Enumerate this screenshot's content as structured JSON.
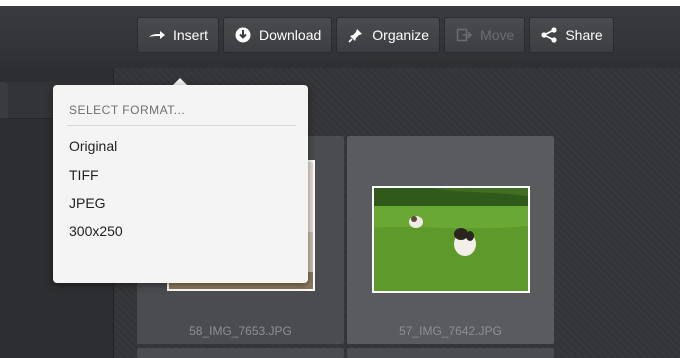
{
  "toolbar": {
    "insert": "Insert",
    "download": "Download",
    "organize": "Organize",
    "move": "Move",
    "share": "Share"
  },
  "format_menu": {
    "title": "SELECT FORMAT...",
    "options": [
      "Original",
      "TIFF",
      "JPEG",
      "300x250"
    ]
  },
  "photos": [
    {
      "filename": "58_IMG_7653.JPG"
    },
    {
      "filename": "57_IMG_7642.JPG"
    }
  ],
  "icons": {
    "insert": "arrow-right-icon",
    "download": "download-circle-icon",
    "organize": "pin-icon",
    "move": "move-icon",
    "share": "share-icon"
  },
  "colors": {
    "background": "#2a2b2e",
    "toolbar_button": "#4a4b4f",
    "menu_background": "#f4f4f4",
    "disabled_text": "#6c6d70"
  }
}
